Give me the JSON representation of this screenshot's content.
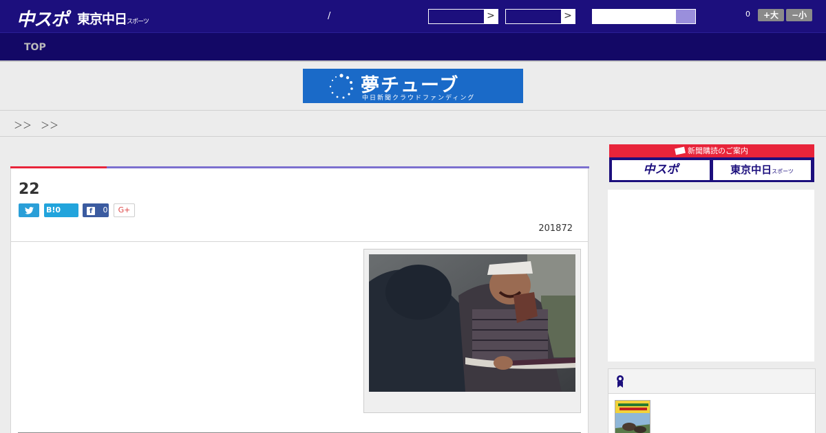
{
  "header": {
    "logo_chuspo": "中スポ",
    "logo_tokyo": "東京中日",
    "logo_tokyo_suffix": "スポーツ",
    "separator": "/",
    "select_arrow": ">",
    "count": "0",
    "font_bigger": "+大",
    "font_smaller": "−小"
  },
  "nav": {
    "top": "TOP"
  },
  "banner": {
    "title": "夢チューブ",
    "subtitle": "中日新聞クラウドファンディング"
  },
  "breadcrumb": "＞＞　＞＞",
  "article": {
    "headline": "22",
    "share": {
      "hatena": "B!0",
      "facebook_count": "0",
      "google": "G+"
    },
    "date": "201872"
  },
  "sidebar": {
    "subscription_heading": "新聞購読のご案内",
    "chuspo_button": "中スポ",
    "tokyo_button": "東京中日",
    "tokyo_button_suffix": "スポーツ"
  },
  "colors": {
    "header_bg": "#1c0f7d",
    "nav_bg": "#130866",
    "accent_red": "#e8243a",
    "accent_blue": "#7b6fcf"
  }
}
